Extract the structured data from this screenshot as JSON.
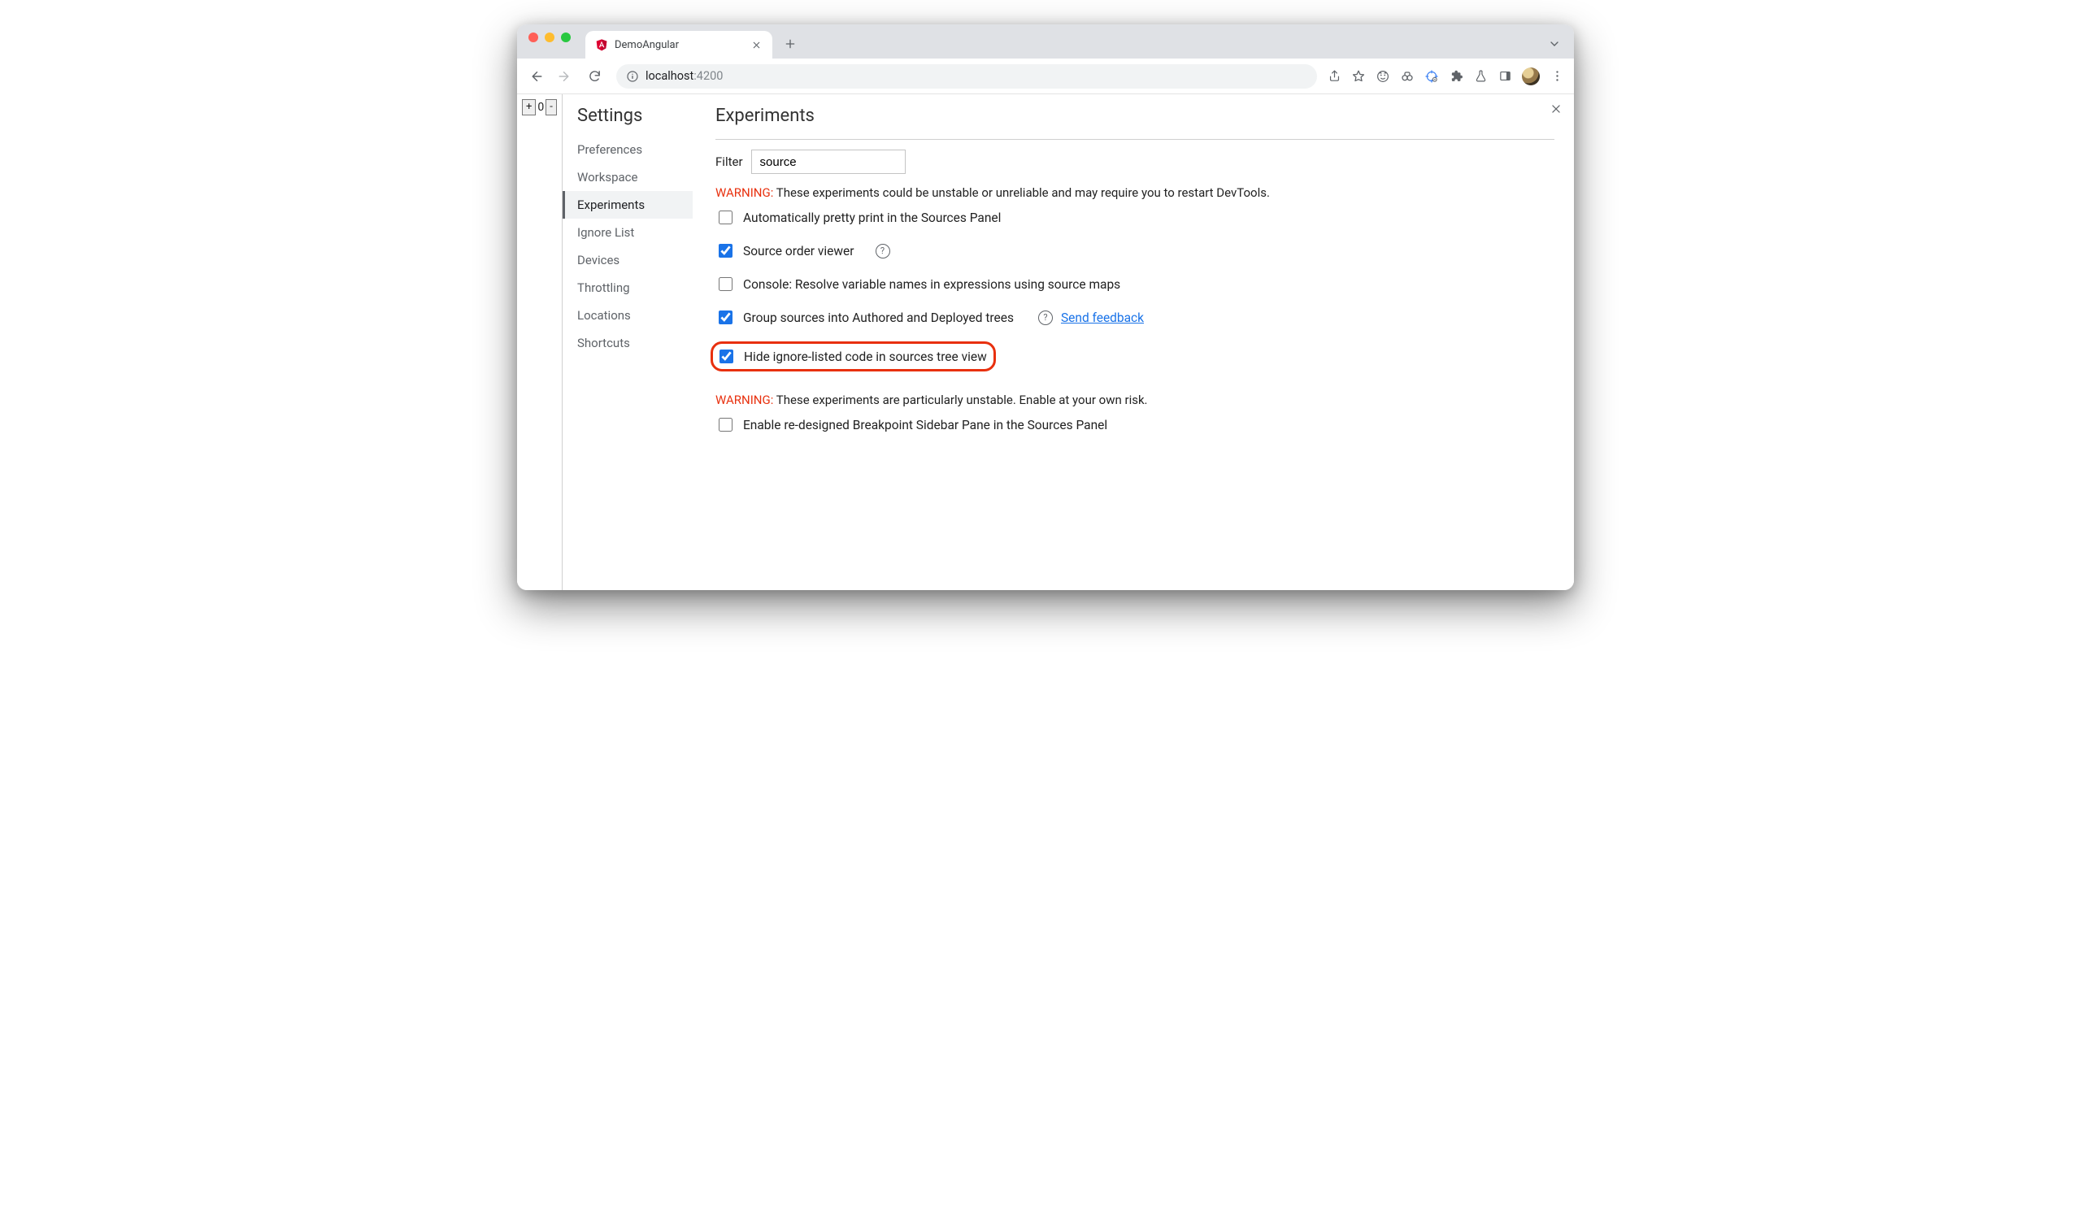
{
  "tab": {
    "title": "DemoAngular"
  },
  "url": {
    "host": "localhost",
    "port": ":4200"
  },
  "page": {
    "counter": {
      "plus": "+",
      "value": "0",
      "minus": "-"
    }
  },
  "settings": {
    "title": "Settings",
    "nav": {
      "preferences": "Preferences",
      "workspace": "Workspace",
      "experiments": "Experiments",
      "ignore_list": "Ignore List",
      "devices": "Devices",
      "throttling": "Throttling",
      "locations": "Locations",
      "shortcuts": "Shortcuts"
    },
    "panel": {
      "heading": "Experiments",
      "filter_label": "Filter",
      "filter_value": "source",
      "warning1_tag": "WARNING:",
      "warning1_text": " These experiments could be unstable or unreliable and may require you to restart DevTools.",
      "exp_auto_pretty": "Automatically pretty print in the Sources Panel",
      "exp_source_order": "Source order viewer",
      "exp_console_resolve": "Console: Resolve variable names in expressions using source maps",
      "exp_group_sources": "Group sources into Authored and Deployed trees",
      "exp_send_feedback": "Send feedback",
      "exp_hide_ignore": "Hide ignore-listed code in sources tree view",
      "warning2_tag": "WARNING:",
      "warning2_text": " These experiments are particularly unstable. Enable at your own risk.",
      "exp_breakpoint_sidebar": "Enable re-designed Breakpoint Sidebar Pane in the Sources Panel"
    }
  }
}
